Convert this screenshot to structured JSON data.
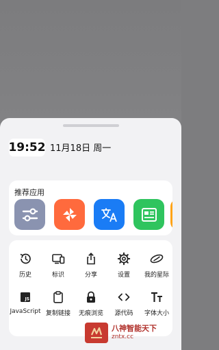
{
  "status": {
    "time": "19:52",
    "date": "11月18日 周一"
  },
  "apps": {
    "title": "推荐应用",
    "items": [
      {
        "name": "settings-sliders-app-icon",
        "color": "#8a93b0"
      },
      {
        "name": "pinwheel-app-icon",
        "color": "#ff6a3d"
      },
      {
        "name": "translate-app-icon",
        "color": "#1a7cf5"
      },
      {
        "name": "news-app-icon",
        "color": "#2fc45e"
      },
      {
        "name": "partial-app-icon",
        "color": "#ffa316"
      }
    ]
  },
  "tools": [
    {
      "label": "历史",
      "icon": "history-icon"
    },
    {
      "label": "标识",
      "icon": "devices-icon"
    },
    {
      "label": "分享",
      "icon": "share-icon"
    },
    {
      "label": "设置",
      "icon": "gear-icon"
    },
    {
      "label": "我的星际",
      "icon": "planet-icon"
    },
    {
      "label": "JavaScript",
      "icon": "javascript-icon"
    },
    {
      "label": "复制链接",
      "icon": "clipboard-icon"
    },
    {
      "label": "无痕浏览",
      "icon": "lock-icon"
    },
    {
      "label": "源代码",
      "icon": "code-icon"
    },
    {
      "label": "字体大小",
      "icon": "font-size-icon"
    }
  ],
  "watermark": {
    "title": "八神智能天下",
    "url": "zntx.cc"
  }
}
